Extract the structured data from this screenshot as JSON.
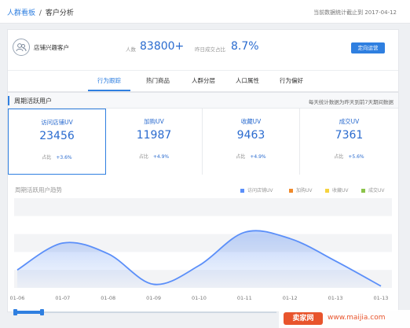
{
  "breadcrumb": {
    "link": "人群看板",
    "separator": "/",
    "current": "客户分析"
  },
  "deadline_text": "当前数据统计截止到 2017-04-12",
  "segment": {
    "name": "店铺兴趣客户",
    "people_label": "人数",
    "people_value": "83800+",
    "conversion_label": "昨日成交占比",
    "conversion_value": "8.7%",
    "action_button": "定向运营"
  },
  "tabs": [
    "行为跟踪",
    "热门商品",
    "人群分层",
    "人口属性",
    "行为偏好"
  ],
  "active_tab": "行为跟踪",
  "section": {
    "title": "周期活跃用户",
    "note": "每天统计数据为昨天到前7天期间数据"
  },
  "metrics": [
    {
      "label": "访问店铺UV",
      "value": "23456",
      "ratio_label": "占比",
      "ratio": "+3.6%"
    },
    {
      "label": "加购UV",
      "value": "11987",
      "ratio_label": "占比",
      "ratio": "+4.9%"
    },
    {
      "label": "收藏UV",
      "value": "9463",
      "ratio_label": "占比",
      "ratio": "+4.9%"
    },
    {
      "label": "成交UV",
      "value": "7361",
      "ratio_label": "占比",
      "ratio": "+5.6%"
    }
  ],
  "trend": {
    "title": "周期活跃用户趋势"
  },
  "legend": [
    {
      "name": "访问店铺UV",
      "color": "#5b8ff9"
    },
    {
      "name": "加购UV",
      "color": "#f08a2b"
    },
    {
      "name": "收藏UV",
      "color": "#f5d33f"
    },
    {
      "name": "成交UV",
      "color": "#8bc34a"
    }
  ],
  "chart_data": {
    "type": "area",
    "x": [
      "01-06",
      "01-07",
      "01-08",
      "01-09",
      "01-10",
      "01-11",
      "01-12",
      "01-13",
      "01-13"
    ],
    "series": [
      {
        "name": "访问店铺UV",
        "values": [
          20,
          50,
          38,
          4,
          25,
          62,
          55,
          30,
          2
        ]
      }
    ],
    "ylim": [
      0,
      100
    ],
    "grid": "horizontal bands",
    "legend_position": "top-right"
  },
  "watermark": {
    "badge": "卖家网",
    "url": "www.maijia.com"
  },
  "colors": {
    "accent": "#2f7fe0",
    "value_blue": "#2a6bcf",
    "line": "#5b8ff9"
  }
}
